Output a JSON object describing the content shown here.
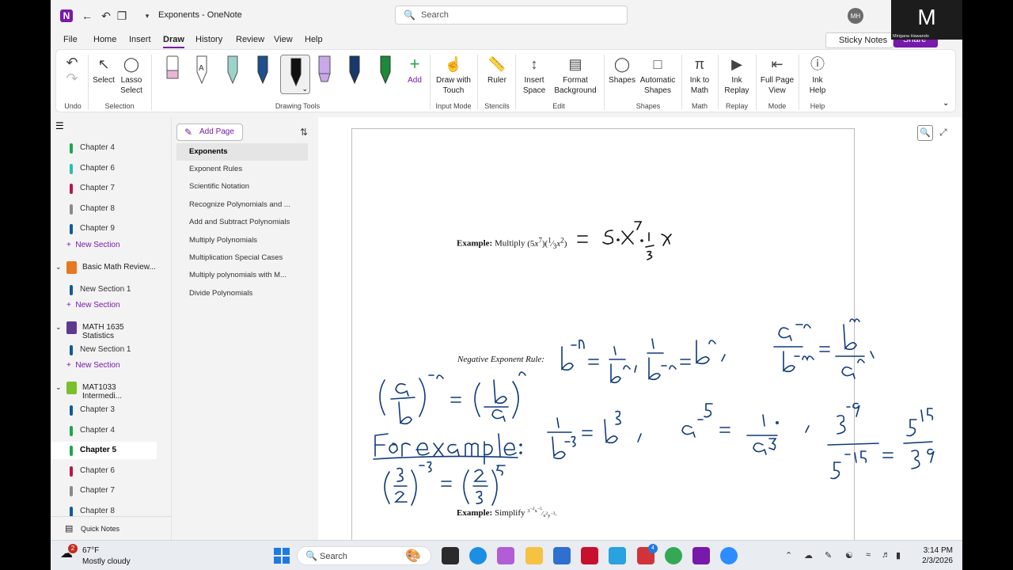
{
  "window": {
    "title": "Exponents  -  OneNote",
    "search_placeholder": "Search",
    "avatar_initials": "MH"
  },
  "menu": [
    "File",
    "Home",
    "Insert",
    "Draw",
    "History",
    "Review",
    "View",
    "Help"
  ],
  "menu_active": "Draw",
  "top_right": {
    "sticky_notes": "Sticky Notes",
    "share": "Share"
  },
  "ribbon": {
    "undo_group": "Undo",
    "selection": {
      "select": "Select",
      "lasso": "Lasso",
      "lasso2": "Select",
      "group": "Selection"
    },
    "drawing_tools": {
      "add": "Add",
      "group": "Drawing Tools"
    },
    "input_mode": {
      "draw_touch": "Draw with",
      "draw_touch2": "Touch",
      "group": "Input Mode"
    },
    "stencils": {
      "ruler": "Ruler",
      "group": "Stencils"
    },
    "edit": {
      "insert_space": "Insert",
      "insert_space2": "Space",
      "format_bg": "Format",
      "format_bg2": "Background",
      "group": "Edit"
    },
    "shapes": {
      "shapes": "Shapes",
      "auto": "Automatic",
      "auto2": "Shapes",
      "group": "Shapes"
    },
    "math": {
      "ink_math": "Ink to",
      "ink_math2": "Math",
      "group": "Math"
    },
    "replay": {
      "ink_replay": "Ink",
      "ink_replay2": "Replay",
      "group": "Replay"
    },
    "mode": {
      "full_page": "Full Page",
      "full_page2": "View",
      "group": "Mode"
    },
    "help": {
      "ink_help": "Ink",
      "ink_help2": "Help",
      "group": "Help"
    }
  },
  "nav": {
    "sections_top": [
      {
        "label": "Chapter 4",
        "color": "#19a94b"
      },
      {
        "label": "Chapter 6",
        "color": "#26bfae"
      },
      {
        "label": "Chapter 7",
        "color": "#b8174a"
      },
      {
        "label": "Chapter 8",
        "color": "#8a8a8a"
      },
      {
        "label": "Chapter 9",
        "color": "#0f5a9c"
      }
    ],
    "new_section": "New Section",
    "notebooks": [
      {
        "label": "Basic Math Review...",
        "color": "#e87722",
        "sections": [
          {
            "label": "New Section 1",
            "color": "#0f5a9c"
          }
        ]
      },
      {
        "label": "MATH 1635 Statistics",
        "color": "#5c3b8e",
        "sections": [
          {
            "label": "New Section 1",
            "color": "#0f5a9c"
          }
        ]
      },
      {
        "label": "MAT1033 Intermedi...",
        "color": "#7bbf2a",
        "sections": [
          {
            "label": "Chapter 3",
            "color": "#0f5a9c"
          },
          {
            "label": "Chapter 4",
            "color": "#19a94b"
          },
          {
            "label": "Chapter 5",
            "color": "#19a94b"
          },
          {
            "label": "Chapter 6",
            "color": "#b8174a"
          },
          {
            "label": "Chapter 7",
            "color": "#8a8a8a"
          },
          {
            "label": "Chapter 8",
            "color": "#0f5a9c"
          }
        ]
      }
    ],
    "quick_notes": "Quick Notes"
  },
  "pages": {
    "add_page": "Add Page",
    "items": [
      "Exponents",
      "Exponent Rules",
      "Scientific Notation",
      "Recognize Polynomials and ...",
      "Add and Subtract Polynomials",
      "Multiply Polynomials",
      "Multiplication Special Cases",
      "Multiply polynomials with M...",
      "Divide Polynomials"
    ],
    "selected": "Exponents"
  },
  "canvas": {
    "example1_bold": "Example:",
    "example1_text": "Multiply",
    "neg_rule": "Negative Exponent Rule:",
    "example2_bold": "Example:",
    "example2_text": "Simplify",
    "ink_for_example": "For example:"
  },
  "taskbar": {
    "weather_temp": "67°F",
    "weather_cond": "Mostly cloudy",
    "weather_badge": "2",
    "search": "Search",
    "time": "3:14 PM",
    "date": "2/3/2026",
    "mail_badge": "4"
  },
  "webcam": {
    "initial": "M",
    "name": "Mirigana Hawando"
  }
}
